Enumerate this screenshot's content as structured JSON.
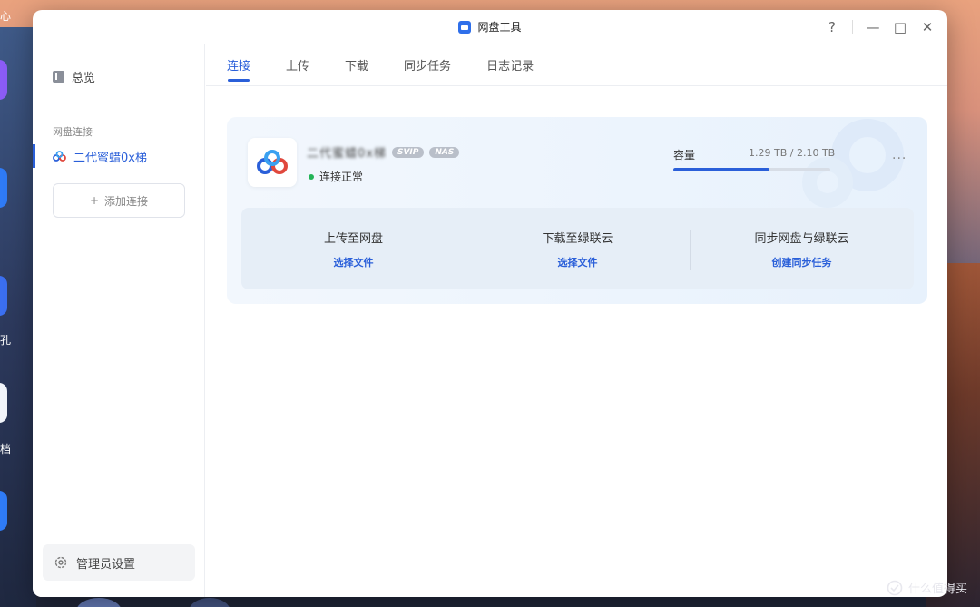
{
  "desktop": {
    "labels": [
      "心",
      "孔",
      "档"
    ],
    "watermark": "什么值得买"
  },
  "window": {
    "title": "网盘工具",
    "controls": {
      "help": "?",
      "minimize": "—",
      "maximize": "□",
      "close": "✕"
    }
  },
  "sidebar": {
    "overview_label": "总览",
    "section_title": "网盘连接",
    "active_item_label": "二代蜜蜡0x梯",
    "add_label": "添加连接",
    "admin_label": "管理员设置"
  },
  "tabs": [
    {
      "label": "连接",
      "active": true
    },
    {
      "label": "上传",
      "active": false
    },
    {
      "label": "下载",
      "active": false
    },
    {
      "label": "同步任务",
      "active": false
    },
    {
      "label": "日志记录",
      "active": false
    }
  ],
  "card": {
    "account_name": "二代蜜蜡0x梯",
    "badges": [
      "SVIP",
      "NAS"
    ],
    "status_text": "连接正常",
    "status_color": "#23b457",
    "capacity_label": "容量",
    "capacity_used": "1.29 TB",
    "capacity_total": "2.10 TB",
    "capacity_fraction": 0.614,
    "more_icon": "more-dots-icon",
    "actions": [
      {
        "title": "上传至网盘",
        "link": "选择文件"
      },
      {
        "title": "下载至绿联云",
        "link": "选择文件"
      },
      {
        "title": "同步网盘与绿联云",
        "link": "创建同步任务"
      }
    ]
  },
  "accent_color": "#2a5fd9"
}
